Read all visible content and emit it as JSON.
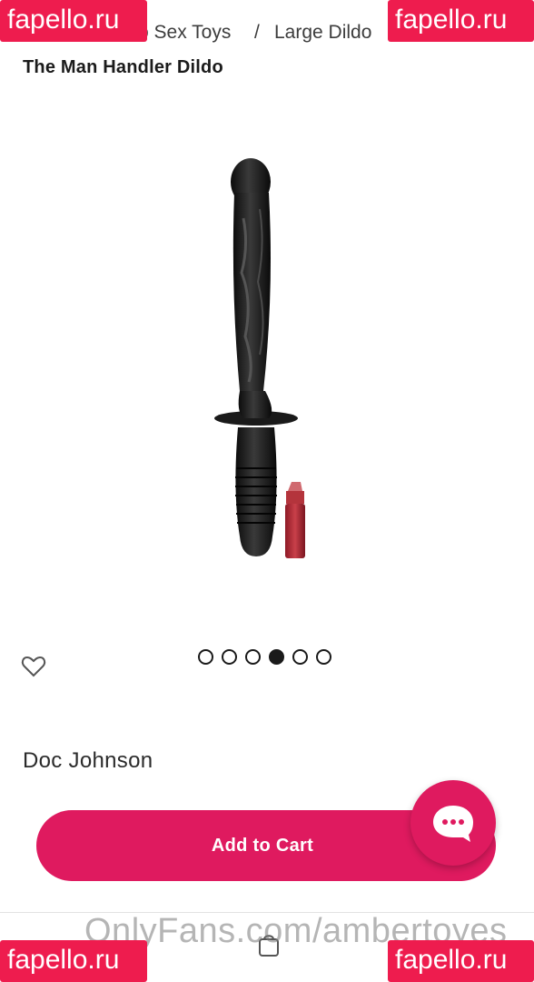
{
  "breadcrumb": {
    "items": [
      "o Sex Toys",
      "Large Dildo"
    ],
    "separator": "/"
  },
  "header": {
    "title": "The Man Handler Dildo"
  },
  "gallery": {
    "slide_count": 6,
    "active_index": 3
  },
  "product": {
    "brand": "Doc Johnson",
    "title": "The Man Handler Dildo"
  },
  "cart": {
    "button_label": "Add to Cart"
  },
  "chat": {
    "icon": "chat-bubble-icon"
  },
  "watermarks": {
    "site": "fapello.ru",
    "onlyfans": "OnlyFans.com/ambertoyes"
  },
  "colors": {
    "accent": "#df1a5f",
    "badge": "#ee1c4e"
  }
}
